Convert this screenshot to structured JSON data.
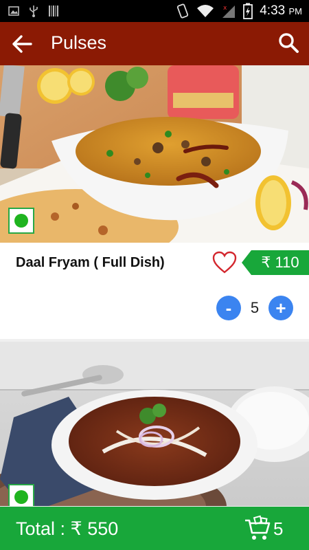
{
  "status_bar": {
    "time": "4:33",
    "ampm": "PM",
    "icons": [
      "image-icon",
      "usb-icon",
      "barcode-icon",
      "phone-vibrate-icon",
      "wifi-icon",
      "signal-icon",
      "battery-charging-icon"
    ]
  },
  "app_bar": {
    "title": "Pulses",
    "back_icon": "arrow-back-icon",
    "search_icon": "search-icon",
    "color": "#8b1a04"
  },
  "items": [
    {
      "name": "Daal Fryam ( Full Dish)",
      "price": "₹ 110",
      "quantity": "5",
      "minus_label": "-",
      "plus_label": "+",
      "favorite_icon": "heart-outline-icon",
      "veg_icon": "veg-mark-icon"
    },
    {
      "veg_icon": "veg-mark-icon"
    }
  ],
  "footer": {
    "total": "Total : ₹ 550",
    "cart_count": "5",
    "cart_icon": "shopping-cart-icon",
    "color": "#18a73a"
  },
  "colors": {
    "price_tag": "#18a73a",
    "qty_button": "#3b84f0",
    "heart": "#d3262d"
  }
}
